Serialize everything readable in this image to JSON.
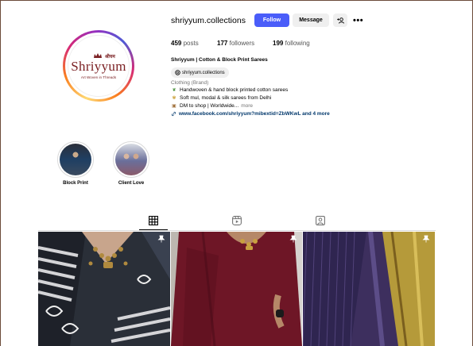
{
  "profile": {
    "username": "shriyyum.collections",
    "follow_label": "Follow",
    "message_label": "Message",
    "suggest_label": "+A",
    "more_label": "•••",
    "stats": {
      "posts_count": "459",
      "posts_label": "posts",
      "followers_count": "177",
      "followers_label": "followers",
      "following_count": "199",
      "following_label": "following"
    },
    "bio": {
      "name": "Shriyyum | Cotton & Block Print Sarees",
      "threads_handle": "shriyyum.collections",
      "category": "Clothing (Brand)",
      "line1": "Handwoven & hand block printed cotton sarees",
      "line2": "Soft mul, modal & silk sarees from Delhi",
      "line3": "DM to shop | Worldwide...",
      "more_label": "more",
      "link": "www.facebook.com/shriyyum?mibextid=ZbWKwL and 4 more"
    },
    "avatar": {
      "logo_text": "Shriyyum",
      "logo_hindi": "श्रीयम",
      "logo_tagline": "Art Woven in Threads"
    }
  },
  "highlights": [
    {
      "label": "Block Print"
    },
    {
      "label": "Client Love"
    }
  ],
  "tabs": [
    {
      "icon": "grid-icon",
      "active": true
    },
    {
      "icon": "reels-icon",
      "active": false
    },
    {
      "icon": "tagged-icon",
      "active": false
    }
  ],
  "posts": [
    {
      "icon": "pin-icon",
      "pinned": true
    },
    {
      "icon": "pin-icon",
      "pinned": true
    },
    {
      "icon": "pin-icon",
      "pinned": true
    }
  ],
  "colors": {
    "accent": "#4a5df9",
    "link": "#00376b",
    "brand": "#7a1f22"
  }
}
